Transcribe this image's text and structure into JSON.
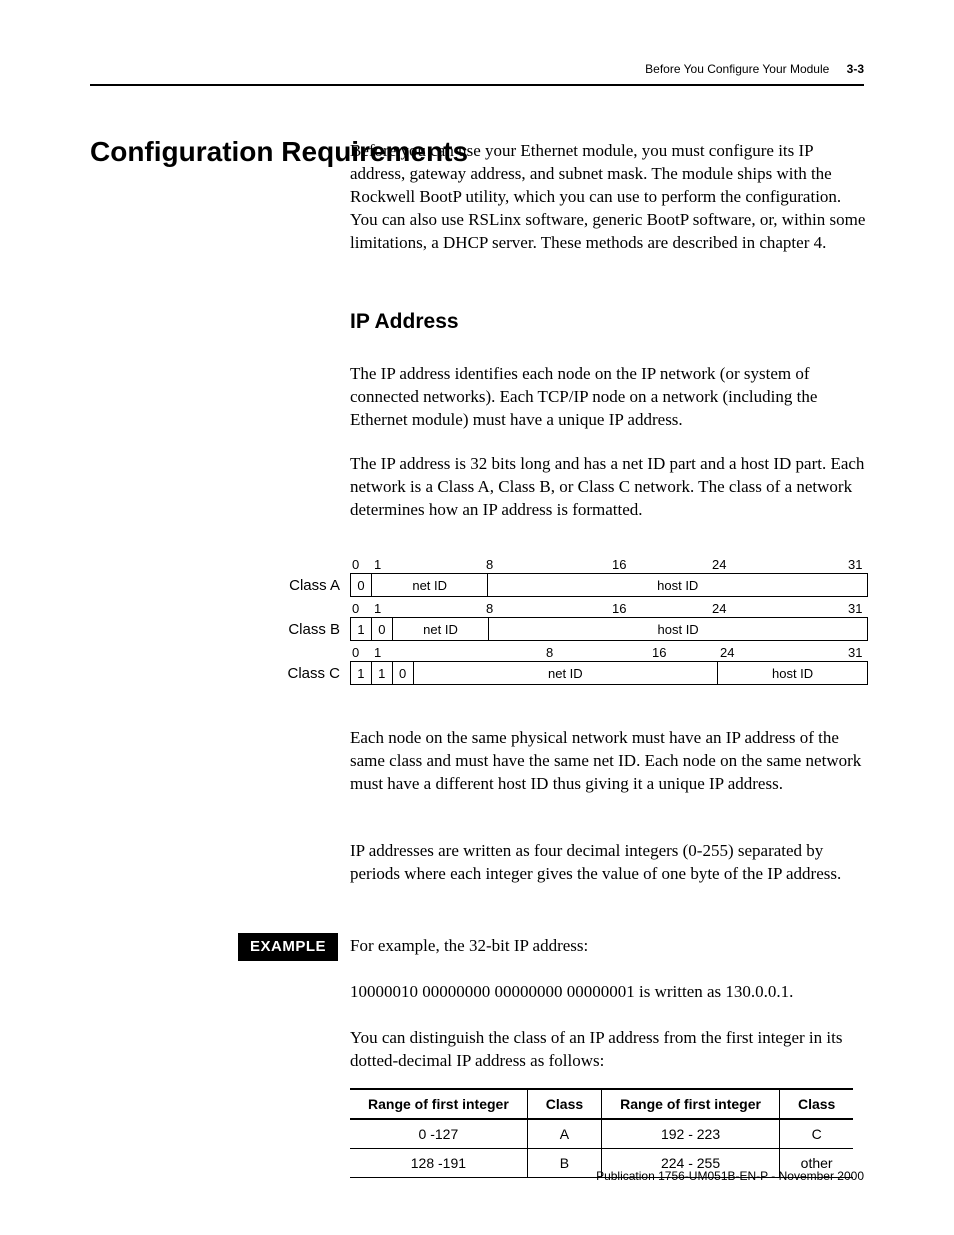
{
  "running": {
    "title": "Before You Configure Your Module",
    "section": "3-3"
  },
  "h1": "Configuration Requirements",
  "para1": "Before you can use your Ethernet module, you must configure its IP address, gateway address, and subnet mask. The module ships with the Rockwell BootP utility, which you can use to perform the configuration. You can also use RSLinx software, generic BootP software, or, within some limitations, a DHCP server. These methods are described in chapter 4.",
  "h2": "IP Address",
  "para2": "The IP address identifies each node on the IP network (or system of connected networks). Each TCP/IP node on a network (including the Ethernet module) must have a unique IP address.",
  "para3": "The IP address is 32 bits long and has a net ID part and a host ID part. Each network is a Class A, Class B, or Class C network. The class of a network determines how an IP address is formatted.",
  "diagram": {
    "ticks_lo": "0",
    "ticks_1": "1",
    "ticks_8": "8",
    "ticks_16": "16",
    "ticks_24": "24",
    "ticks_31": "31",
    "rows": [
      {
        "label": "Class A",
        "bits": [
          "0"
        ],
        "net": "net ID",
        "host": "host ID"
      },
      {
        "label": "Class B",
        "bits": [
          "1",
          "0"
        ],
        "net": "net ID",
        "host": "host ID"
      },
      {
        "label": "Class C",
        "bits": [
          "1",
          "1",
          "0"
        ],
        "net": "net ID",
        "host": "host ID"
      }
    ]
  },
  "para4": "Each node on the same physical network must have an IP address of the same class and must have the same net ID. Each node on the same network must have a different host ID thus giving it a unique IP address.",
  "para5": "IP addresses are written as four decimal integers (0-255) separated by periods where each integer gives the value of one byte of the IP address.",
  "example_label": "EXAMPLE",
  "para6": "For example, the 32-bit IP address:",
  "para7": "10000010 00000000 00000000 00000001 is written as 130.0.0.1.",
  "para8": "You can distinguish the class of an IP address from the first integer in its dotted-decimal IP address as follows:",
  "table": {
    "headers": [
      "Range of first integer",
      "Class",
      "Range of first integer",
      "Class"
    ],
    "rows": [
      [
        "0 -127",
        "A",
        "192 - 223",
        "C"
      ],
      [
        "128 -191",
        "B",
        "224 - 255",
        "other"
      ]
    ]
  },
  "footer": "Publication 1756-UM051B-EN-P - November 2000"
}
